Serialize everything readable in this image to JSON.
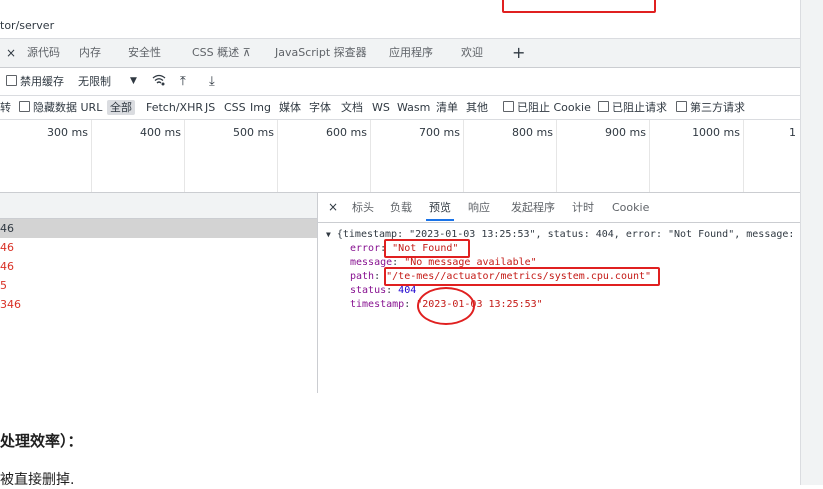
{
  "urlbar": {
    "url_fragment": "tor/server"
  },
  "devtools_tabs": {
    "close": "×",
    "items": [
      "源代码",
      "内存",
      "安全性",
      "CSS 概述 ⊼",
      "JavaScript 探查器",
      "应用程序",
      "欢迎"
    ],
    "add": "+"
  },
  "toolbar": {
    "disable_cache": "禁用缓存",
    "throttle": "无限制",
    "throttle_arrow": "▼",
    "wifi_icon": "wifi",
    "upload_icon": "⤒",
    "download_icon": "⤓"
  },
  "filters": {
    "invert": "转",
    "hide_data_url": "隐藏数据 URL",
    "all": "全部",
    "types": [
      "Fetch/XHR",
      "JS",
      "CSS",
      "Img",
      "媒体",
      "字体",
      "文档",
      "WS",
      "Wasm",
      "清单",
      "其他"
    ],
    "blocked_cookies": "已阻止 Cookie",
    "blocked_requests": "已阻止请求",
    "third_party": "第三方请求"
  },
  "timeline": {
    "ticks": [
      "300 ms",
      "400 ms",
      "500 ms",
      "600 ms",
      "700 ms",
      "800 ms",
      "900 ms",
      "1000 ms",
      "1"
    ]
  },
  "request_list": {
    "rows": [
      {
        "text": "46",
        "state": "selected"
      },
      {
        "text": "46",
        "state": "error"
      },
      {
        "text": "46",
        "state": "error"
      },
      {
        "text": "5",
        "state": "error"
      },
      {
        "text": "346",
        "state": "error"
      }
    ]
  },
  "detail": {
    "close": "×",
    "tabs": [
      "标头",
      "负载",
      "预览",
      "响应",
      "发起程序",
      "计时",
      "Cookie"
    ],
    "active_tab": "预览",
    "json": {
      "summary": "{timestamp: \"2023-01-03 13:25:53\", status: 404, error: \"Not Found\", message:",
      "error_key": "error",
      "error_val": "\"Not Found\"",
      "message_key": "message",
      "message_val": "\"No message available\"",
      "path_key": "path",
      "path_val": "\"/te-mes//actuator/metrics/system.cpu.count\"",
      "status_key": "status",
      "status_val": "404",
      "timestamp_key": "timestamp",
      "timestamp_val": "\"2023-01-03 13:25:53\""
    }
  },
  "doc": {
    "heading": "处理效率）：",
    "text": "被直接删掉."
  },
  "colors": {
    "annotation_red": "#e02020",
    "error_red": "#d93025",
    "accent_blue": "#1a73e8"
  }
}
